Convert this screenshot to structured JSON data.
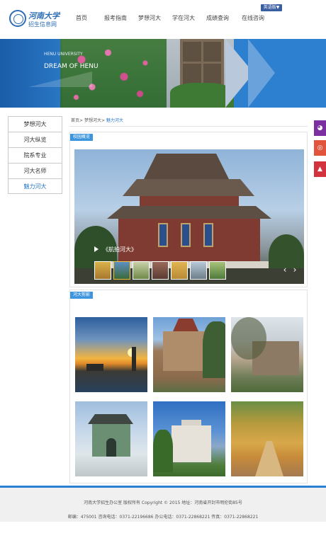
{
  "header": {
    "logo_name": "河南大学",
    "logo_sub": "招生信息网",
    "lang_button": "英语版▼",
    "nav": [
      {
        "label": "首页"
      },
      {
        "label": "报考指南"
      },
      {
        "label": "梦想河大"
      },
      {
        "label": "学在河大"
      },
      {
        "label": "成绩查询"
      },
      {
        "label": "在线咨询"
      }
    ]
  },
  "banner": {
    "line1": "HENU UNIVERSITY",
    "line2": "DREAM  OF  HENU"
  },
  "sidebar": {
    "items": [
      {
        "label": "梦想河大"
      },
      {
        "label": "河大纵览"
      },
      {
        "label": "院系专业"
      },
      {
        "label": "河大名师"
      },
      {
        "label": "魅力河大"
      }
    ],
    "active_index": 4
  },
  "breadcrumb": {
    "home": "首页",
    "sep": ">",
    "parent": "梦想河大",
    "current": "魅力河大"
  },
  "overview": {
    "tag": "校园概览",
    "caption": "《航拍河大》",
    "prev_icon": "‹",
    "next_icon": "›"
  },
  "gallery": {
    "tag": "河大剪影"
  },
  "footer": {
    "row1": "河南大学招生办公室 版权所有 Copyright © 2015 地址：河南省开封市明伦街85号",
    "row2": "邮编：475001 咨询电话：0371-22196686 办公电话：0371-22868221 传真：0371-22868221"
  },
  "floats": {
    "wechat_icon": "wechat-icon",
    "weibo_icon": "weibo-icon",
    "top_icon": "back-to-top-icon"
  },
  "colors": {
    "accent": "#2276c8",
    "tag": "#3d95dd",
    "footer_line": "#2a7fd0"
  }
}
